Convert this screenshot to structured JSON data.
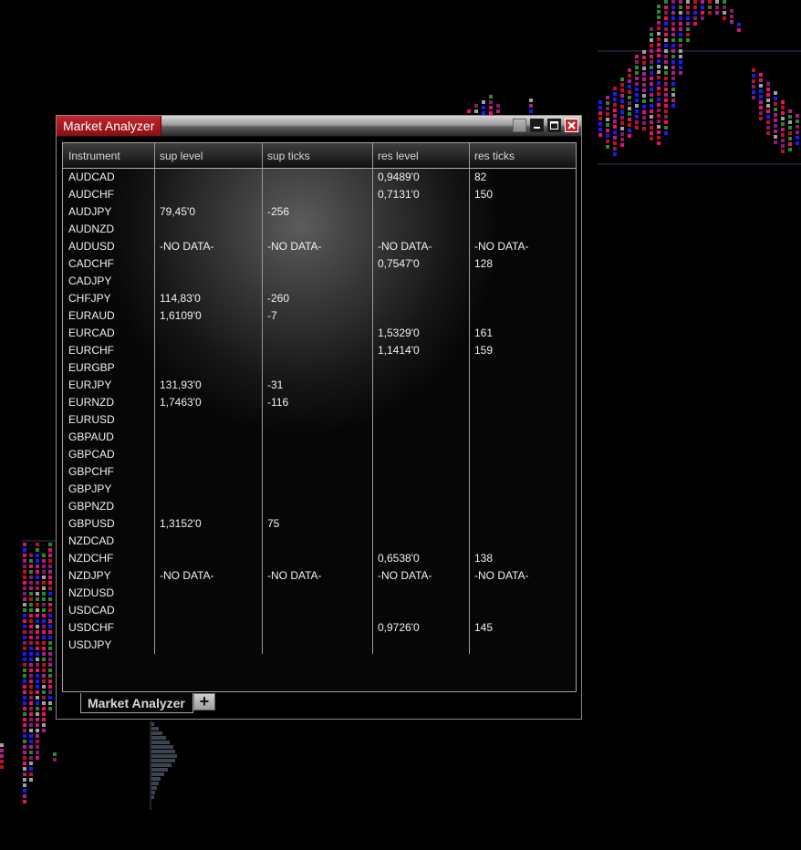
{
  "window": {
    "title": "Market Analyzer"
  },
  "grid": {
    "columns": [
      "Instrument",
      "sup level",
      "sup ticks",
      "res level",
      "res ticks"
    ],
    "rows": [
      [
        "AUDCAD",
        "",
        "",
        "0,9489'0",
        "82"
      ],
      [
        "AUDCHF",
        "",
        "",
        "0,7131'0",
        "150"
      ],
      [
        "AUDJPY",
        "79,45'0",
        "-256",
        "",
        ""
      ],
      [
        "AUDNZD",
        "",
        "",
        "",
        ""
      ],
      [
        "AUDUSD",
        "-NO DATA-",
        "-NO DATA-",
        "-NO DATA-",
        "-NO DATA-"
      ],
      [
        "CADCHF",
        "",
        "",
        "0,7547'0",
        "128"
      ],
      [
        "CADJPY",
        "",
        "",
        "",
        ""
      ],
      [
        "CHFJPY",
        "114,83'0",
        "-260",
        "",
        ""
      ],
      [
        "EURAUD",
        "1,6109'0",
        "-7",
        "",
        ""
      ],
      [
        "EURCAD",
        "",
        "",
        "1,5329'0",
        "161"
      ],
      [
        "EURCHF",
        "",
        "",
        "1,1414'0",
        "159"
      ],
      [
        "EURGBP",
        "",
        "",
        "",
        ""
      ],
      [
        "EURJPY",
        "131,93'0",
        "-31",
        "",
        ""
      ],
      [
        "EURNZD",
        "1,7463'0",
        "-116",
        "",
        ""
      ],
      [
        "EURUSD",
        "",
        "",
        "",
        ""
      ],
      [
        "GBPAUD",
        "",
        "",
        "",
        ""
      ],
      [
        "GBPCAD",
        "",
        "",
        "",
        ""
      ],
      [
        "GBPCHF",
        "",
        "",
        "",
        ""
      ],
      [
        "GBPJPY",
        "",
        "",
        "",
        ""
      ],
      [
        "GBPNZD",
        "",
        "",
        "",
        ""
      ],
      [
        "GBPUSD",
        "1,3152'0",
        "75",
        "",
        ""
      ],
      [
        "NZDCAD",
        "",
        "",
        "",
        ""
      ],
      [
        "NZDCHF",
        "",
        "",
        "0,6538'0",
        "138"
      ],
      [
        "NZDJPY",
        "-NO DATA-",
        "-NO DATA-",
        "-NO DATA-",
        "-NO DATA-"
      ],
      [
        "NZDUSD",
        "",
        "",
        "",
        ""
      ],
      [
        "USDCAD",
        "",
        "",
        "",
        ""
      ],
      [
        "USDCHF",
        "",
        "",
        "0,9726'0",
        "145"
      ],
      [
        "USDJPY",
        "",
        "",
        "",
        ""
      ]
    ]
  },
  "tabs": {
    "active_label": "Market Analyzer",
    "add_label": "+"
  },
  "colors": {
    "title_tab": "#c0272e",
    "chart_palette": [
      "#e8106a",
      "#c01020",
      "#8a1a6a",
      "#1a1aff",
      "#2a8a2a",
      "#a0a0a0",
      "#b01c8a"
    ]
  },
  "icons": [
    "window-menu-icon",
    "minimize-icon",
    "maximize-icon",
    "close-icon",
    "add-tab-icon"
  ]
}
